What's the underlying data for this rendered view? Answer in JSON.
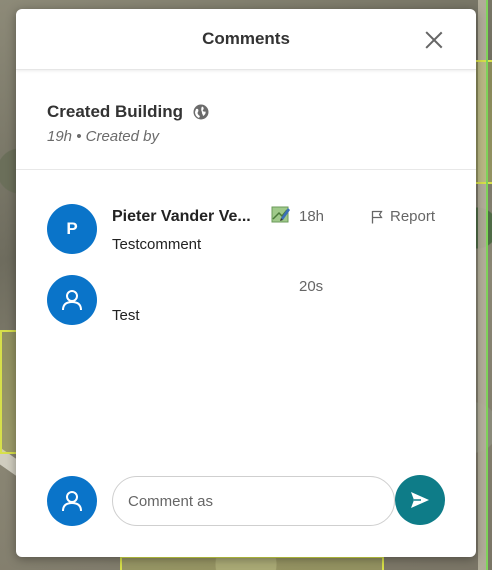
{
  "panel": {
    "title": "Comments",
    "close_icon": "close-icon"
  },
  "post": {
    "title": "Created Building",
    "visibility_icon": "globe-icon",
    "meta": "19h • Created by"
  },
  "comments": [
    {
      "avatar_letter": "P",
      "author": "Pieter Vander Ve...",
      "badge_icon": "map-edit-icon",
      "time": "18h",
      "report_label": "Report",
      "text": "Testcomment"
    },
    {
      "avatar_icon": "user-icon",
      "time": "20s",
      "text": "Test"
    }
  ],
  "composer": {
    "avatar_icon": "user-icon",
    "placeholder": "Comment as",
    "send_icon": "send-icon"
  },
  "colors": {
    "accent": "#0a74c9",
    "send": "#0e7c88"
  }
}
